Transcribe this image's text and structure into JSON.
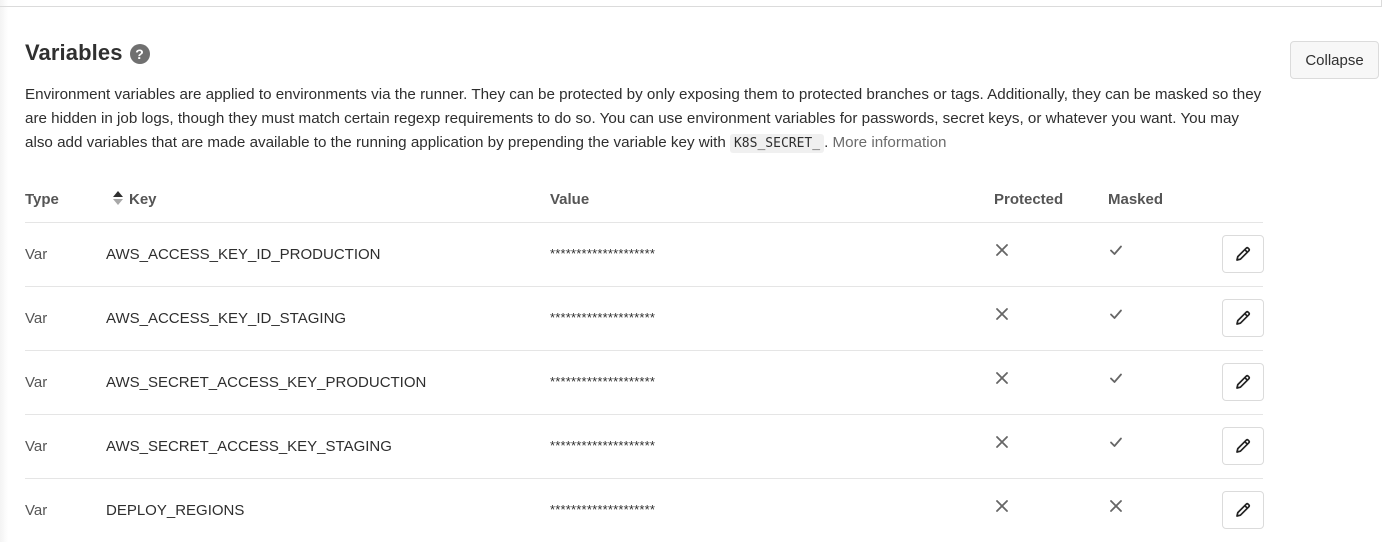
{
  "section": {
    "title": "Variables",
    "collapse_label": "Collapse",
    "description": {
      "text": "Environment variables are applied to environments via the runner. They can be protected by only exposing them to protected branches or tags. Additionally, they can be masked so they are hidden in job logs, though they must match certain regexp requirements to do so. You can use environment variables for passwords, secret keys, or whatever you want. You may also add variables that are made available to the running application by prepending the variable key with ",
      "code": "K8S_SECRET_",
      "after": ". ",
      "link": "More information"
    }
  },
  "table": {
    "headers": {
      "type": "Type",
      "key": "Key",
      "value": "Value",
      "protected": "Protected",
      "masked": "Masked"
    },
    "rows": [
      {
        "type": "Var",
        "key": "AWS_ACCESS_KEY_ID_PRODUCTION",
        "value": "********************",
        "protected": false,
        "masked": true
      },
      {
        "type": "Var",
        "key": "AWS_ACCESS_KEY_ID_STAGING",
        "value": "********************",
        "protected": false,
        "masked": true
      },
      {
        "type": "Var",
        "key": "AWS_SECRET_ACCESS_KEY_PRODUCTION",
        "value": "********************",
        "protected": false,
        "masked": true
      },
      {
        "type": "Var",
        "key": "AWS_SECRET_ACCESS_KEY_STAGING",
        "value": "********************",
        "protected": false,
        "masked": true
      },
      {
        "type": "Var",
        "key": "DEPLOY_REGIONS",
        "value": "********************",
        "protected": false,
        "masked": false
      }
    ]
  },
  "icons": {
    "help": "question-circle-icon",
    "sort": "sort-ascending-icon",
    "true": "check-icon",
    "false": "close-icon",
    "edit": "pencil-icon"
  },
  "colors": {
    "icon_gray": "#666666",
    "border": "#e5e5e5",
    "button_bg": "#f7f7f7"
  }
}
